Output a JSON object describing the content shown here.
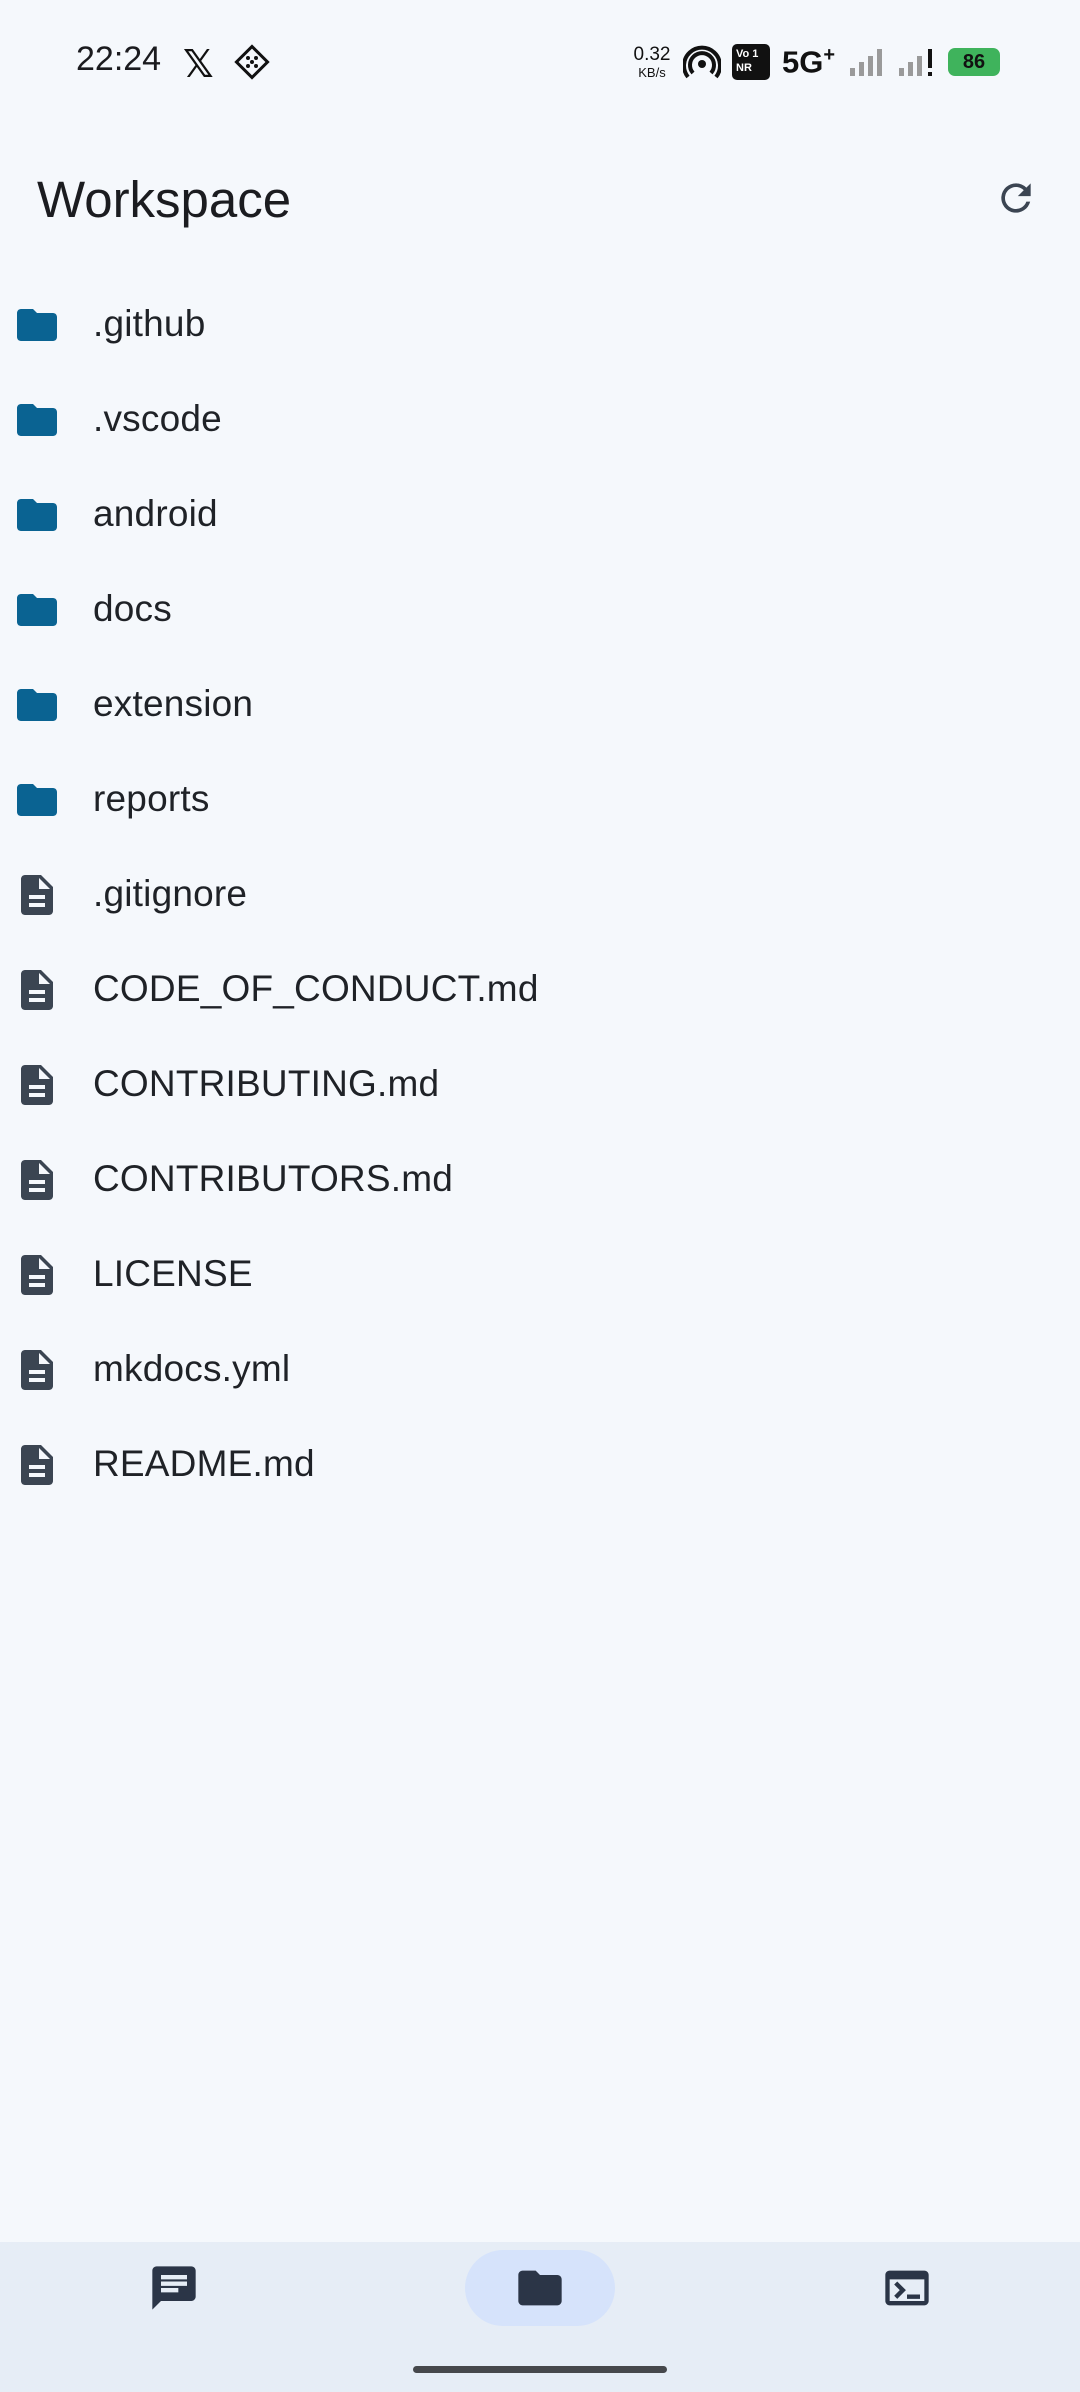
{
  "status_bar": {
    "time": "22:24",
    "net_speed_value": "0.32",
    "net_speed_unit": "KB/s",
    "volte_line1": "Vo 1",
    "volte_line2": "NR",
    "network_type": "5G",
    "network_plus": "+",
    "battery": "86",
    "icons": [
      "x-logo-icon",
      "app-notification-icon",
      "hotspot-icon",
      "volte-icon",
      "signal-icon",
      "signal-weak-icon",
      "battery-charging-icon"
    ]
  },
  "header": {
    "title": "Workspace",
    "refresh_icon": "refresh-icon"
  },
  "files": [
    {
      "name": ".github",
      "kind": "folder"
    },
    {
      "name": ".vscode",
      "kind": "folder"
    },
    {
      "name": "android",
      "kind": "folder"
    },
    {
      "name": "docs",
      "kind": "folder"
    },
    {
      "name": "extension",
      "kind": "folder"
    },
    {
      "name": "reports",
      "kind": "folder"
    },
    {
      "name": ".gitignore",
      "kind": "file"
    },
    {
      "name": "CODE_OF_CONDUCT.md",
      "kind": "file"
    },
    {
      "name": "CONTRIBUTING.md",
      "kind": "file"
    },
    {
      "name": "CONTRIBUTORS.md",
      "kind": "file"
    },
    {
      "name": "LICENSE",
      "kind": "file"
    },
    {
      "name": "mkdocs.yml",
      "kind": "file"
    },
    {
      "name": "README.md",
      "kind": "file"
    }
  ],
  "bottom_nav": {
    "items": [
      {
        "icon": "chat-icon",
        "active": false
      },
      {
        "icon": "folder-icon",
        "active": true
      },
      {
        "icon": "terminal-icon",
        "active": false
      }
    ]
  },
  "colors": {
    "background": "#f5f8fc",
    "folder_icon": "#0a6392",
    "file_icon": "#3b4552",
    "nav_background": "#e6edf6",
    "nav_active_pill": "#d6e3fb",
    "battery": "#3fb35c"
  }
}
